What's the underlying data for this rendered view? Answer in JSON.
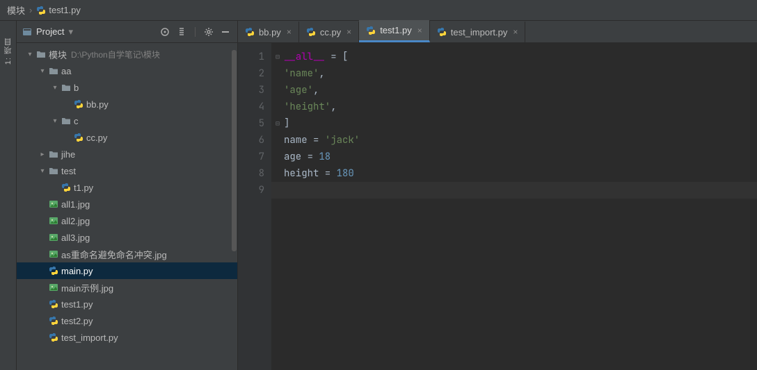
{
  "breadcrumbs": [
    {
      "label": "模块"
    },
    {
      "label": "test1.py",
      "icon": "py"
    }
  ],
  "leftbar": {
    "label": "1: 项目"
  },
  "sidebar": {
    "header": {
      "title": "Project"
    },
    "tree": [
      {
        "depth": 0,
        "expand": "down",
        "icon": "folder",
        "label": "模块",
        "note": "D:\\Python自学笔记\\模块"
      },
      {
        "depth": 1,
        "expand": "down",
        "icon": "folder",
        "label": "aa"
      },
      {
        "depth": 2,
        "expand": "down",
        "icon": "folder",
        "label": "b"
      },
      {
        "depth": 3,
        "expand": "",
        "icon": "py",
        "label": "bb.py"
      },
      {
        "depth": 2,
        "expand": "down",
        "icon": "folder",
        "label": "c"
      },
      {
        "depth": 3,
        "expand": "",
        "icon": "py",
        "label": "cc.py"
      },
      {
        "depth": 1,
        "expand": "right",
        "icon": "folder",
        "label": "jihe"
      },
      {
        "depth": 1,
        "expand": "down",
        "icon": "folder",
        "label": "test"
      },
      {
        "depth": 2,
        "expand": "",
        "icon": "py",
        "label": "t1.py"
      },
      {
        "depth": 1,
        "expand": "",
        "icon": "img",
        "label": "all1.jpg"
      },
      {
        "depth": 1,
        "expand": "",
        "icon": "img",
        "label": "all2.jpg"
      },
      {
        "depth": 1,
        "expand": "",
        "icon": "img",
        "label": "all3.jpg"
      },
      {
        "depth": 1,
        "expand": "",
        "icon": "img",
        "label": "as重命名避免命名冲突.jpg"
      },
      {
        "depth": 1,
        "expand": "",
        "icon": "py",
        "label": "main.py",
        "selected": true
      },
      {
        "depth": 1,
        "expand": "",
        "icon": "img",
        "label": "main示例.jpg"
      },
      {
        "depth": 1,
        "expand": "",
        "icon": "py",
        "label": "test1.py"
      },
      {
        "depth": 1,
        "expand": "",
        "icon": "py",
        "label": "test2.py"
      },
      {
        "depth": 1,
        "expand": "",
        "icon": "py",
        "label": "test_import.py"
      }
    ]
  },
  "tabs": [
    {
      "label": "bb.py",
      "icon": "py",
      "active": false
    },
    {
      "label": "cc.py",
      "icon": "py",
      "active": false
    },
    {
      "label": "test1.py",
      "icon": "py",
      "active": true
    },
    {
      "label": "test_import.py",
      "icon": "py",
      "active": false
    }
  ],
  "editor": {
    "caret_line": 9,
    "lines": [
      {
        "n": 1,
        "fold": "open",
        "tokens": [
          [
            "dun",
            "__all__"
          ],
          [
            "op",
            " = ["
          ]
        ]
      },
      {
        "n": 2,
        "tokens": [
          [
            "op",
            "    "
          ],
          [
            "str",
            "'name'"
          ],
          [
            "op",
            ","
          ]
        ]
      },
      {
        "n": 3,
        "tokens": [
          [
            "op",
            "    "
          ],
          [
            "str",
            "'age'"
          ],
          [
            "op",
            ","
          ]
        ]
      },
      {
        "n": 4,
        "tokens": [
          [
            "op",
            "    "
          ],
          [
            "str",
            "'height'"
          ],
          [
            "op",
            ","
          ]
        ]
      },
      {
        "n": 5,
        "fold": "close",
        "tokens": [
          [
            "op",
            "]"
          ]
        ]
      },
      {
        "n": 6,
        "tokens": [
          [
            "id",
            "name"
          ],
          [
            "op",
            " = "
          ],
          [
            "str",
            "'jack'"
          ]
        ]
      },
      {
        "n": 7,
        "tokens": [
          [
            "id",
            "age"
          ],
          [
            "op",
            " = "
          ],
          [
            "num",
            "18"
          ]
        ]
      },
      {
        "n": 8,
        "tokens": [
          [
            "id",
            "height"
          ],
          [
            "op",
            " = "
          ],
          [
            "num",
            "180"
          ]
        ]
      },
      {
        "n": 9,
        "tokens": []
      }
    ]
  },
  "colors": {
    "accent": "#4a88c7",
    "selection": "#0d293e",
    "bg": "#2b2b2b",
    "panel": "#3c3f41"
  }
}
